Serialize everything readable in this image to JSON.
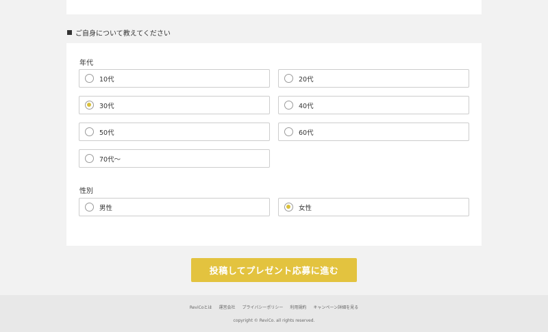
{
  "section": {
    "heading": "ご自身について教えてください"
  },
  "age": {
    "label": "年代",
    "options": [
      {
        "label": "10代",
        "selected": false
      },
      {
        "label": "20代",
        "selected": false
      },
      {
        "label": "30代",
        "selected": true
      },
      {
        "label": "40代",
        "selected": false
      },
      {
        "label": "50代",
        "selected": false
      },
      {
        "label": "60代",
        "selected": false
      },
      {
        "label": "70代〜",
        "selected": false
      }
    ]
  },
  "gender": {
    "label": "性別",
    "options": [
      {
        "label": "男性",
        "selected": false
      },
      {
        "label": "女性",
        "selected": true
      }
    ]
  },
  "submit": {
    "label": "投稿してプレゼント応募に進む"
  },
  "footer": {
    "links": [
      "ReviCoとは",
      "運営会社",
      "プライバシーポリシー",
      "利用規約",
      "キャンペーン詳細を見る"
    ],
    "copyright": "copyright © ReviCo. all rights reserved."
  },
  "colors": {
    "accent": "#e3c33f",
    "radio_dot": "#d9bf3a",
    "background": "#f2f2f2"
  }
}
